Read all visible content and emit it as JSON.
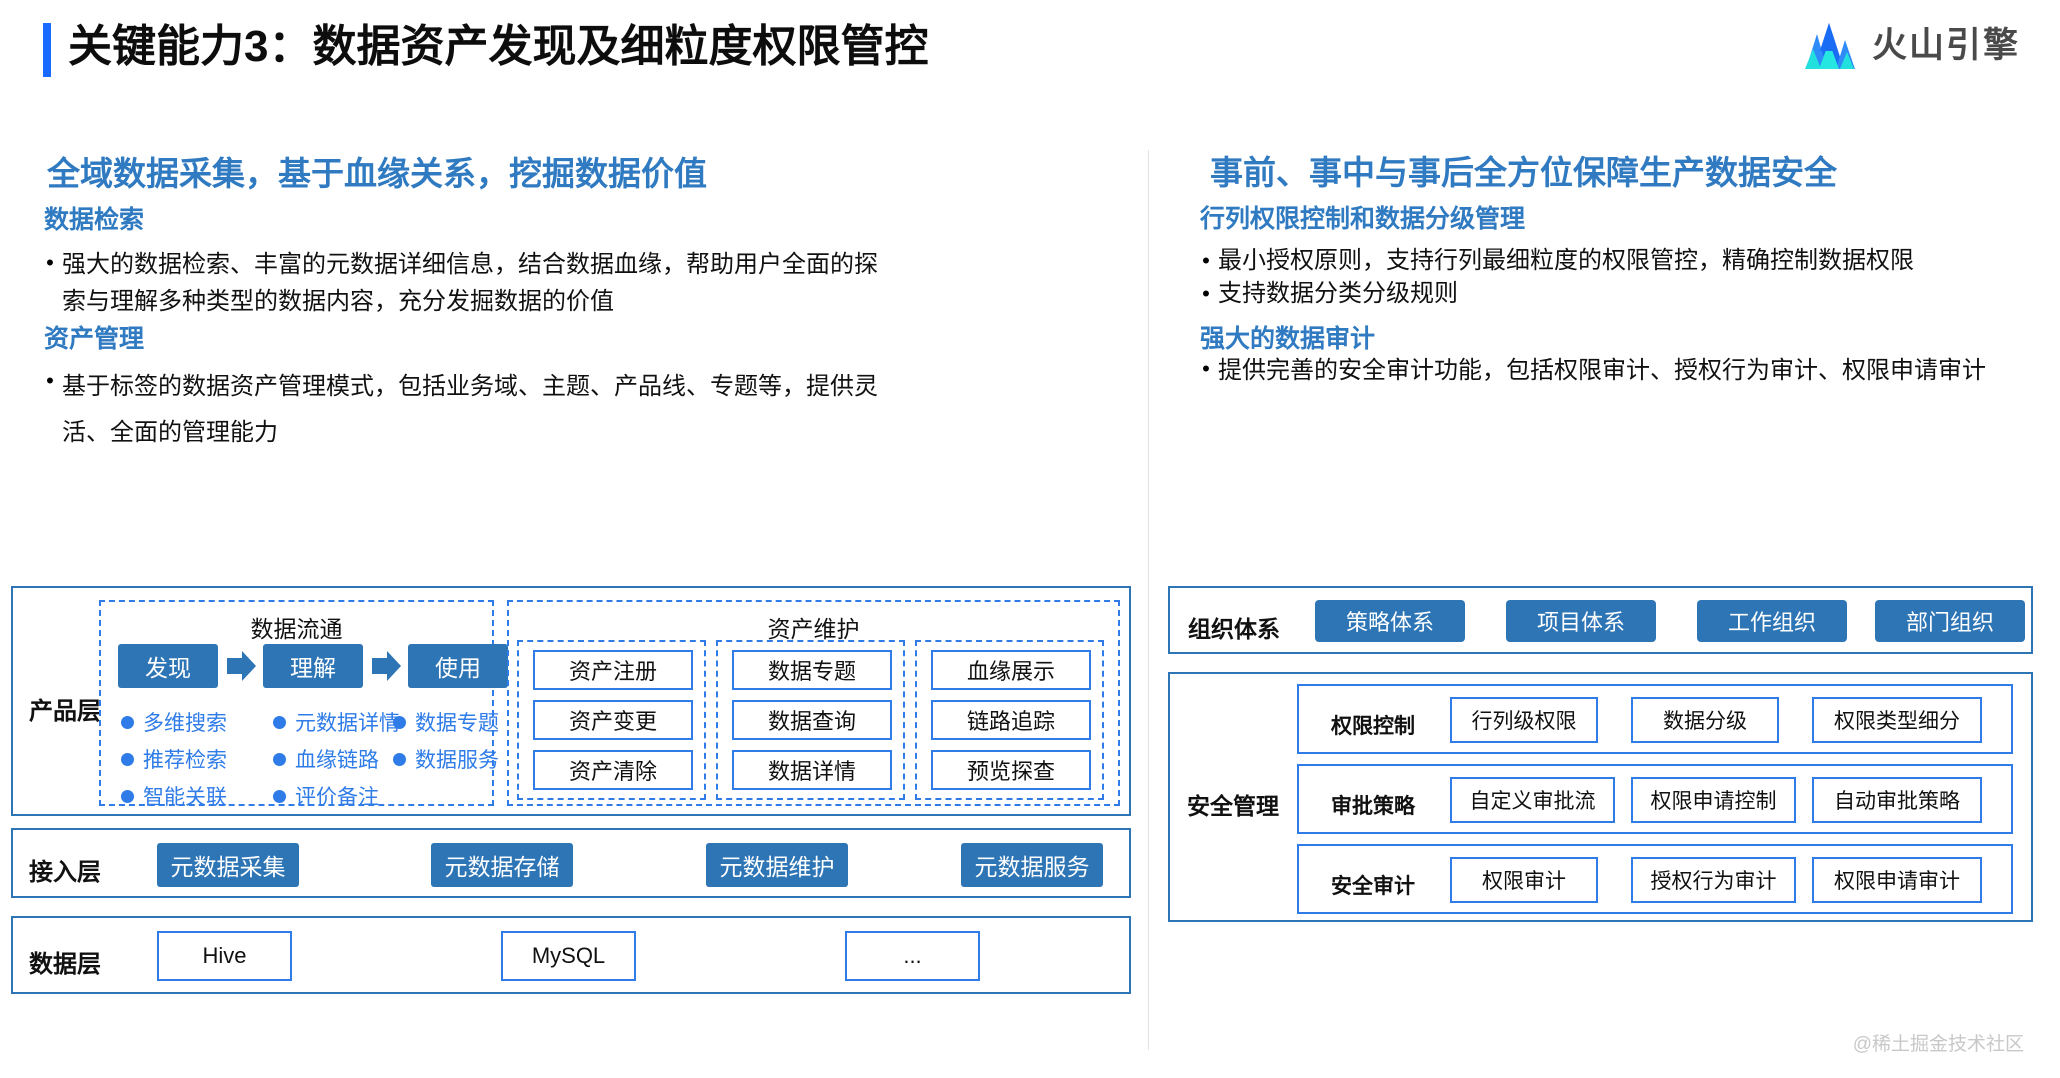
{
  "header": {
    "title": "关键能力3：数据资产发现及细粒度权限管控",
    "logo_text": "火山引擎",
    "accent_bar_color": "#1769ff"
  },
  "left": {
    "section_title": "全域数据采集，基于血缘关系，挖掘数据价值",
    "sub_title_1": "数据检索",
    "bullet_1": "强大的数据检索、丰富的元数据详细信息，结合数据血缘，帮助用户全面的探索与理解多种类型的数据内容，充分发掘数据的价值",
    "sub_title_2": "资产管理",
    "bullet_2": "基于标签的数据资产管理模式，包括业务域、主题、产品线、专题等，提供灵活、全面的管理能力",
    "diagram": {
      "product_layer_label": "产品层",
      "flow_group_title": "数据流通",
      "flow_steps": [
        "发现",
        "理解",
        "使用"
      ],
      "flow_links": [
        [
          "多维搜索",
          "推荐检索",
          "智能关联"
        ],
        [
          "元数据详情",
          "血缘链路",
          "评价备注"
        ],
        [
          "数据专题",
          "数据服务"
        ]
      ],
      "maint_group_title": "资产维护",
      "maint_columns": [
        [
          "资产注册",
          "资产变更",
          "资产清除"
        ],
        [
          "数据专题",
          "数据查询",
          "数据详情"
        ],
        [
          "血缘展示",
          "链路追踪",
          "预览探查"
        ]
      ],
      "access_layer_label": "接入层",
      "access_items": [
        "元数据采集",
        "元数据存储",
        "元数据维护",
        "元数据服务"
      ],
      "data_layer_label": "数据层",
      "data_items": [
        "Hive",
        "MySQL",
        "..."
      ]
    }
  },
  "right": {
    "section_title": "事前、事中与事后全方位保障生产数据安全",
    "sub_title_1": "行列权限控制和数据分级管理",
    "bullets_1": [
      "最小授权原则，支持行列最细粒度的权限管控，精确控制数据权限",
      "支持数据分类分级规则"
    ],
    "sub_title_2": "强大的数据审计",
    "bullet_2": "提供完善的安全审计功能，包括权限审计、授权行为审计、权限申请审计",
    "diagram": {
      "org_layer_label": "组织体系",
      "org_items": [
        "策略体系",
        "项目体系",
        "工作组织",
        "部门组织"
      ],
      "security_layer_label": "安全管理",
      "security_rows": [
        {
          "label": "权限控制",
          "items": [
            "行列级权限",
            "数据分级",
            "权限类型细分"
          ]
        },
        {
          "label": "审批策略",
          "items": [
            "自定义审批流",
            "权限申请控制",
            "自动审批策略"
          ]
        },
        {
          "label": "安全审计",
          "items": [
            "权限审计",
            "授权行为审计",
            "权限申请审计"
          ]
        }
      ]
    }
  },
  "watermark": "@稀土掘金技术社区",
  "colors": {
    "accent_blue": "#2e75b6",
    "bright_blue": "#2f7ce8",
    "title_bar": "#1769ff",
    "heading_blue": "#2f7ac1"
  }
}
